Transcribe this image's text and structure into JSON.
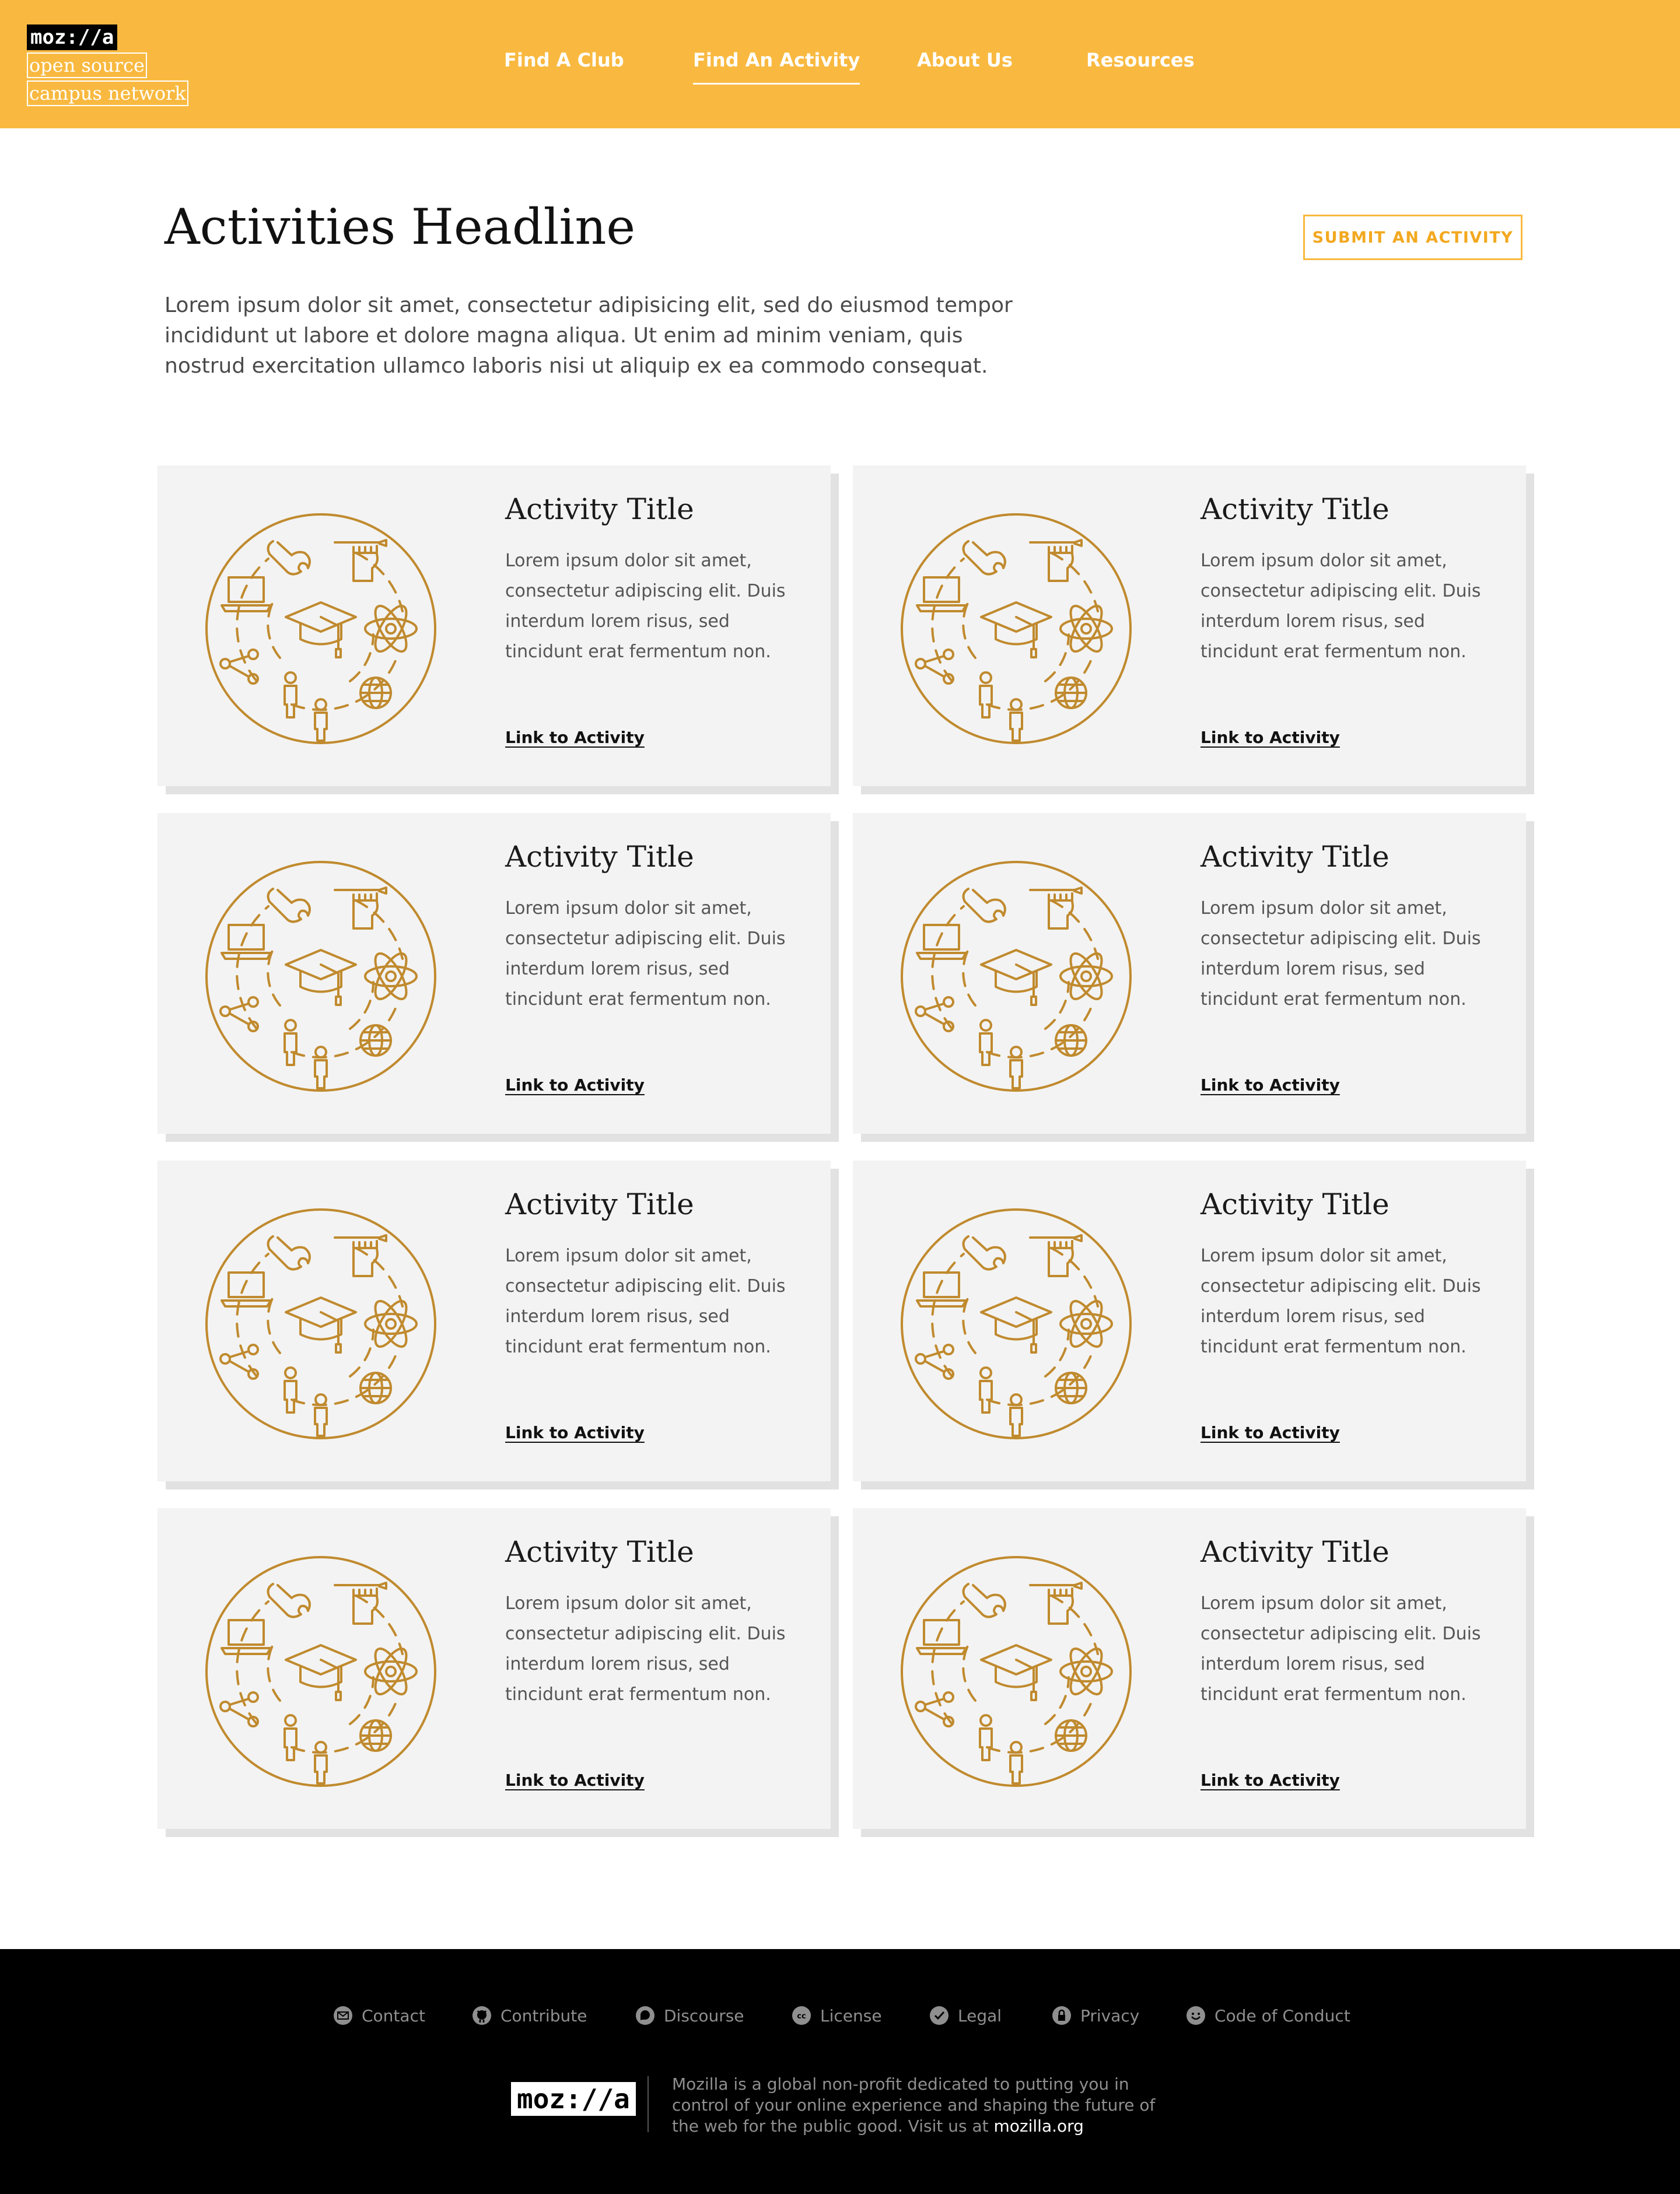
{
  "header": {
    "logo": {
      "word": "moz://a",
      "line1": "open source",
      "line2": "campus network"
    },
    "nav": [
      {
        "label": "Find A Club",
        "active": false
      },
      {
        "label": "Find An Activity",
        "active": true
      },
      {
        "label": "About Us",
        "active": false
      },
      {
        "label": "Resources",
        "active": false
      }
    ]
  },
  "intro": {
    "headline": "Activities Headline",
    "submit_label": "SUBMIT AN ACTIVITY",
    "paragraph": "Lorem ipsum dolor sit amet, consectetur adipisicing elit, sed do eiusmod tempor incididunt ut labore et dolore magna aliqua. Ut enim ad minim veniam, quis nostrud exercitation ullamco laboris nisi ut aliquip ex ea commodo consequat."
  },
  "cards": [
    {
      "title": "Activity Title",
      "description": "Lorem ipsum dolor sit amet, consectetur adipiscing elit. Duis interdum lorem risus, sed tincidunt erat fermentum non.",
      "link": "Link to Activity"
    },
    {
      "title": "Activity Title",
      "description": "Lorem ipsum dolor sit amet, consectetur adipiscing elit. Duis interdum lorem risus, sed tincidunt erat fermentum non.",
      "link": "Link to Activity"
    },
    {
      "title": "Activity Title",
      "description": "Lorem ipsum dolor sit amet, consectetur adipiscing elit. Duis interdum lorem risus, sed tincidunt erat fermentum non.",
      "link": "Link to Activity"
    },
    {
      "title": "Activity Title",
      "description": "Lorem ipsum dolor sit amet, consectetur adipiscing elit. Duis interdum lorem risus, sed tincidunt erat fermentum non.",
      "link": "Link to Activity"
    },
    {
      "title": "Activity Title",
      "description": "Lorem ipsum dolor sit amet, consectetur adipiscing elit. Duis interdum lorem risus, sed tincidunt erat fermentum non.",
      "link": "Link to Activity"
    },
    {
      "title": "Activity Title",
      "description": "Lorem ipsum dolor sit amet, consectetur adipiscing elit. Duis interdum lorem risus, sed tincidunt erat fermentum non.",
      "link": "Link to Activity"
    },
    {
      "title": "Activity Title",
      "description": "Lorem ipsum dolor sit amet, consectetur adipiscing elit. Duis interdum lorem risus, sed tincidunt erat fermentum non.",
      "link": "Link to Activity"
    },
    {
      "title": "Activity Title",
      "description": "Lorem ipsum dolor sit amet, consectetur adipiscing elit. Duis interdum lorem risus, sed tincidunt erat fermentum non.",
      "link": "Link to Activity"
    }
  ],
  "illustration": {
    "icons": [
      "graduation-cap-icon",
      "laptop-icon",
      "wrench-icon",
      "fist-pen-icon",
      "atom-icon",
      "share-icon",
      "person-icon",
      "globe-icon"
    ]
  },
  "footer": {
    "links": [
      {
        "label": "Contact",
        "icon": "mail-icon"
      },
      {
        "label": "Contribute",
        "icon": "github-icon"
      },
      {
        "label": "Discourse",
        "icon": "discourse-icon"
      },
      {
        "label": "License",
        "icon": "cc-icon"
      },
      {
        "label": "Legal",
        "icon": "check-icon"
      },
      {
        "label": "Privacy",
        "icon": "lock-icon"
      },
      {
        "label": "Code of Conduct",
        "icon": "smile-icon"
      }
    ],
    "logo": "moz://a",
    "about_text": "Mozilla is a global non-profit dedicated to putting you in control of your online experience and shaping the future of the web for the public good. Visit us at ",
    "about_link": "mozilla.org"
  },
  "colors": {
    "brand_yellow": "#f9b940",
    "illustration_gold": "#c08a2e",
    "card_bg": "#f3f3f3",
    "footer_bg": "#000000"
  }
}
